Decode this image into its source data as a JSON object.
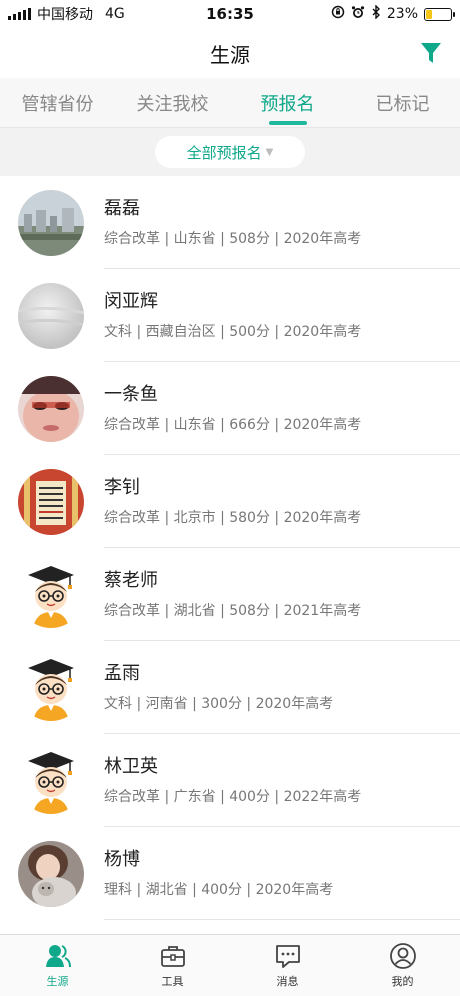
{
  "status_bar": {
    "carrier": "中国移动",
    "network": "4G",
    "time": "16:35",
    "battery_percent": "23%",
    "battery_level": 0.23
  },
  "nav": {
    "title": "生源",
    "filter_icon": "filter-icon",
    "accent_color": "#10a88a"
  },
  "tabs": [
    {
      "label": "管辖省份",
      "active": false
    },
    {
      "label": "关注我校",
      "active": false
    },
    {
      "label": "预报名",
      "active": true
    },
    {
      "label": "已标记",
      "active": false
    }
  ],
  "filter": {
    "label": "全部预报名"
  },
  "students": [
    {
      "name": "磊磊",
      "meta": "综合改革 | 山东省 | 508分 | 2020年高考",
      "avatar": "photo-landscape"
    },
    {
      "name": "闵亚辉",
      "meta": "文科 | 西藏自治区 | 500分 | 2020年高考",
      "avatar": "photo-blurred"
    },
    {
      "name": "一条鱼",
      "meta": "综合改革 | 山东省 | 666分 | 2020年高考",
      "avatar": "photo-face"
    },
    {
      "name": "李钊",
      "meta": "综合改革 | 北京市 | 580分 | 2020年高考",
      "avatar": "photo-poster"
    },
    {
      "name": "蔡老师",
      "meta": "综合改革 | 湖北省 | 508分 | 2021年高考",
      "avatar": "graduate-cartoon"
    },
    {
      "name": "孟雨",
      "meta": "文科 | 河南省 | 300分 | 2020年高考",
      "avatar": "graduate-cartoon"
    },
    {
      "name": "林卫英",
      "meta": "综合改革 | 广东省 | 400分 | 2022年高考",
      "avatar": "graduate-cartoon"
    },
    {
      "name": "杨博",
      "meta": "理科 | 湖北省 | 400分 | 2020年高考",
      "avatar": "photo-cat"
    }
  ],
  "tab_bar": [
    {
      "label": "生源",
      "icon": "people-icon",
      "active": true
    },
    {
      "label": "工具",
      "icon": "toolbox-icon",
      "active": false
    },
    {
      "label": "消息",
      "icon": "message-icon",
      "active": false
    },
    {
      "label": "我的",
      "icon": "profile-icon",
      "active": false
    }
  ]
}
